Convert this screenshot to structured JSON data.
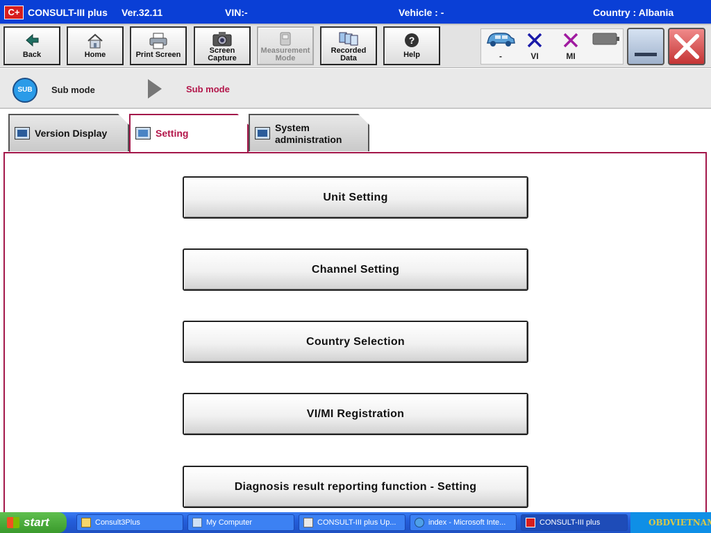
{
  "title_bar": {
    "logo": "C+",
    "app_name": "CONSULT-III plus",
    "version": "Ver.32.11",
    "vin": "VIN:-",
    "vehicle": "Vehicle : -",
    "country": "Country : Albania"
  },
  "toolbar": {
    "buttons": [
      {
        "label": "Back",
        "icon": "back-arrow-icon"
      },
      {
        "label": "Home",
        "icon": "home-icon"
      },
      {
        "label": "Print Screen",
        "icon": "printer-icon"
      },
      {
        "label_line1": "Screen",
        "label_line2": "Capture",
        "icon": "camera-icon"
      },
      {
        "label_line1": "Measurement",
        "label_line2": "Mode",
        "icon": "measurement-icon",
        "disabled": true
      },
      {
        "label_line1": "Recorded",
        "label_line2": "Data",
        "icon": "recorded-data-icon"
      },
      {
        "label": "Help",
        "icon": "help-icon"
      }
    ],
    "status": {
      "vehicle_label": "-",
      "vi_label": "VI",
      "mi_label": "MI"
    }
  },
  "breadcrumb": {
    "badge": "SUB",
    "item1": "Sub mode",
    "item2": "Sub mode"
  },
  "tabs": [
    {
      "label": "Version Display",
      "active": false
    },
    {
      "label": "Setting",
      "active": true
    },
    {
      "label_line1": "System",
      "label_line2": "administration",
      "active": false
    }
  ],
  "menu": [
    "Unit Setting",
    "Channel Setting",
    "Country Selection",
    "VI/MI Registration",
    "Diagnosis result reporting function - Setting"
  ],
  "taskbar": {
    "start": "start",
    "tasks": [
      "Consult3Plus",
      "My Computer",
      "CONSULT-III plus Up...",
      "index - Microsoft Inte...",
      "CONSULT-III plus"
    ],
    "brand": "OBDVIETNAM"
  },
  "colors": {
    "title_blue": "#0a3fd6",
    "accent_crimson": "#b3164a",
    "sub_badge_blue": "#2a9be8",
    "vi_blue": "#1a1aa8",
    "mi_purple": "#a01aa0"
  }
}
